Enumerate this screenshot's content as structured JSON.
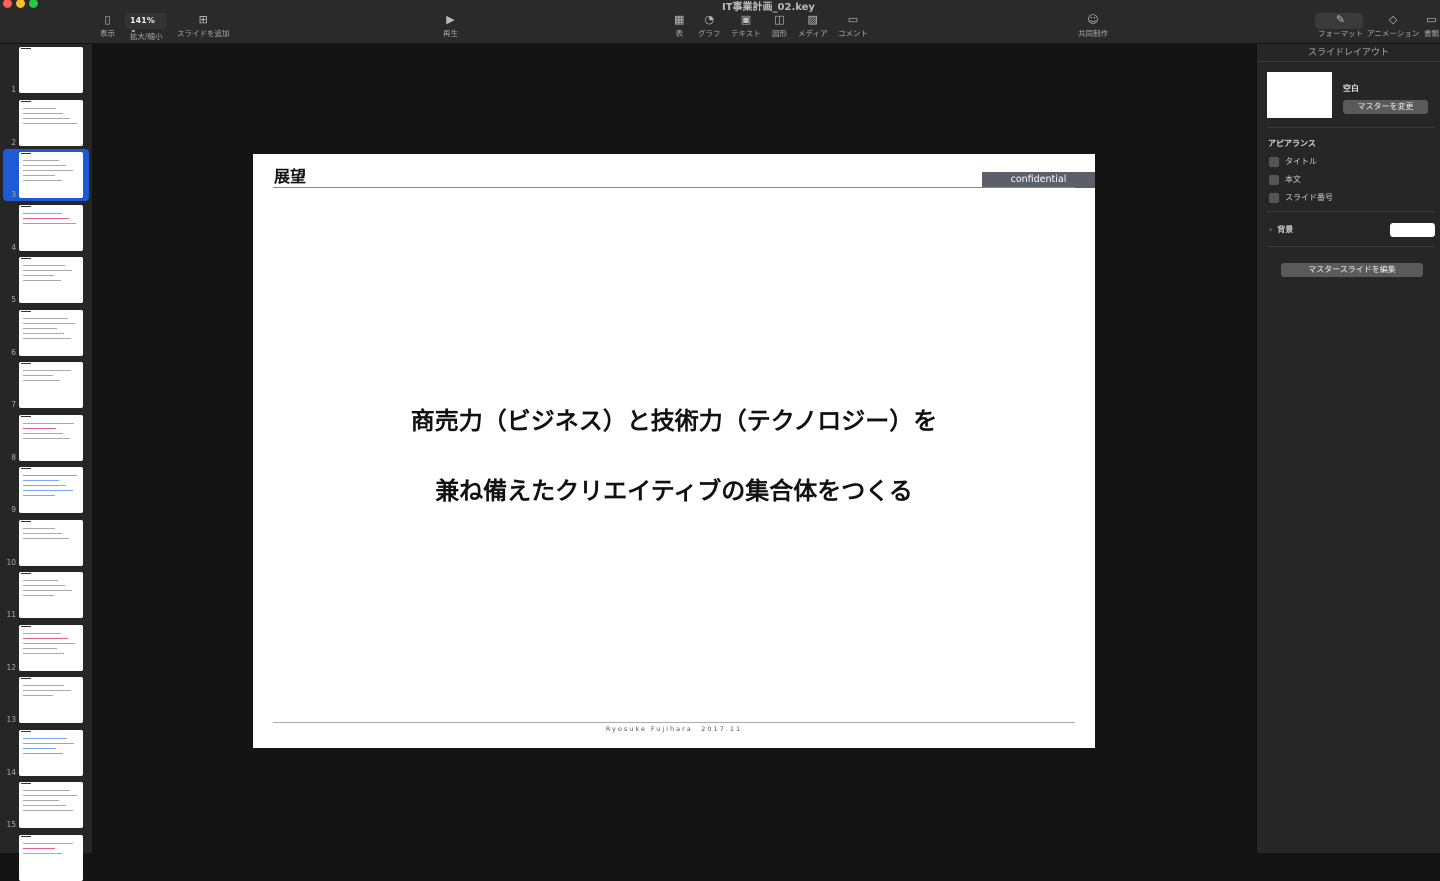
{
  "window": {
    "title": "IT事業計画_02.key"
  },
  "toolbar": {
    "view": "表示",
    "zoom_value": "141%",
    "zoom": "拡大/縮小",
    "add_slide": "スライドを追加",
    "play": "再生",
    "table": "表",
    "chart": "グラフ",
    "text": "テキスト",
    "shape": "図形",
    "media": "メディア",
    "comment": "コメント",
    "collaborate": "共同制作",
    "format": "フォーマット",
    "animate": "アニメーション",
    "document": "書類"
  },
  "sidebar": {
    "slides": [
      "1",
      "2",
      "3",
      "4",
      "5",
      "6",
      "7",
      "8",
      "9",
      "10",
      "11",
      "12",
      "13",
      "14",
      "15"
    ],
    "selected": 3
  },
  "slide": {
    "title": "展望",
    "badge": "confidential",
    "line1": "商売力（ビジネス）と技術力（テクノロジー）を",
    "line2": "兼ね備えたクリエイティブの集合体をつくる",
    "footer": "Ryosuke Fujihara　2017.11"
  },
  "panel": {
    "header": "スライドレイアウト",
    "layout_name": "空白",
    "change_master": "マスターを変更",
    "appearance": "アピアランス",
    "opt_title": "タイトル",
    "opt_body": "本文",
    "opt_number": "スライド番号",
    "background": "背景",
    "edit_master": "マスタースライドを編集"
  },
  "colors": {
    "accent": "#2f7cf6",
    "badge": "#5b5f67"
  }
}
